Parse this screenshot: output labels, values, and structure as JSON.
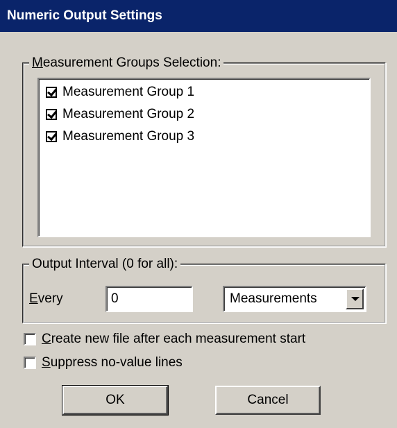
{
  "window": {
    "title": "Numeric Output Settings"
  },
  "groups": {
    "legend_mnemonic": "M",
    "legend_rest": "easurement Groups Selection:",
    "items": [
      {
        "label": "Measurement Group 1",
        "checked": true
      },
      {
        "label": "Measurement Group 2",
        "checked": true
      },
      {
        "label": "Measurement Group 3",
        "checked": true
      }
    ]
  },
  "interval": {
    "legend": "Output Interval (0 for all):",
    "every_mnemonic": "E",
    "every_rest": "very",
    "value": "0",
    "unit": "Measurements"
  },
  "options": {
    "create_new_file": {
      "mnemonic": "C",
      "rest": "reate new file after each measurement start",
      "checked": false
    },
    "suppress_no_value": {
      "mnemonic": "S",
      "rest": "uppress no-value lines",
      "checked": false
    }
  },
  "buttons": {
    "ok": "OK",
    "cancel": "Cancel"
  }
}
